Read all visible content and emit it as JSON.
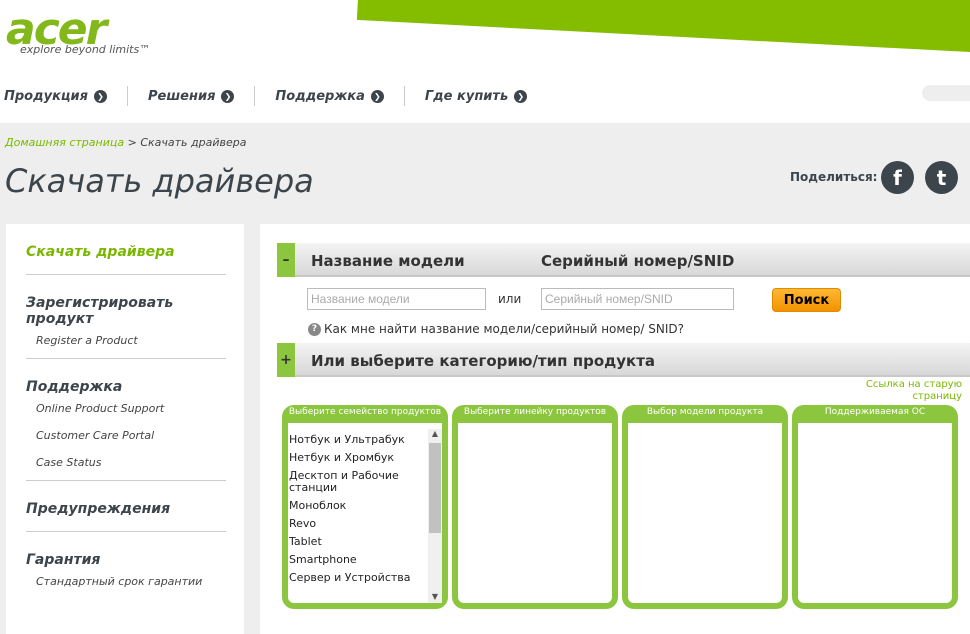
{
  "logo": {
    "brand": "acer",
    "tagline": "explore beyond limits™"
  },
  "nav": [
    "Продукция",
    "Решения",
    "Поддержка",
    "Где купить"
  ],
  "breadcrumb": {
    "home": "Домашняя страница",
    "sep": ">",
    "current": "Скачать драйвера"
  },
  "page_title": "Скачать драйвера",
  "share": {
    "label": "Поделиться:",
    "facebook": "f",
    "twitter": "t"
  },
  "sidebar": [
    {
      "title": "Скачать драйвера",
      "items": []
    },
    {
      "title": "Зарегистрировать продукт",
      "items": [
        "Register a Product"
      ]
    },
    {
      "title": "Поддержка",
      "items": [
        "Online Product Support",
        "Customer Care Portal",
        "Case Status"
      ]
    },
    {
      "title": "Предупреждения",
      "items": []
    },
    {
      "title": "Гарантия",
      "items": [
        "Стандартный срок гарантии"
      ]
    }
  ],
  "search": {
    "toggle": "–",
    "model_heading": "Название модели",
    "serial_heading": "Серийный номер/SNID",
    "model_placeholder": "Название модели",
    "or": "или",
    "serial_placeholder": "Серийный номер/SNID",
    "button": "Поиск",
    "help": "Как мне найти название модели/серийный номер/ SNID?"
  },
  "category": {
    "toggle": "+",
    "heading": "Или выберите категорию/тип продукта",
    "old_link_1": "Ссылка на старую",
    "old_link_2": "страницу"
  },
  "columns": [
    "Выберите семейство продуктов",
    "Выберите линейку продуктов",
    "Выбор модели продукта",
    "Поддерживаемая ОС"
  ],
  "families": [
    "Нотбук и Ультрабук",
    "Нетбук и Хромбук",
    "Десктоп и Рабочие станции",
    "Моноблок",
    "Revo",
    "Tablet",
    "Smartphone",
    "Сервер и Устройства"
  ],
  "colors": {
    "accent": "#8cc63f",
    "button": "#f39200"
  }
}
